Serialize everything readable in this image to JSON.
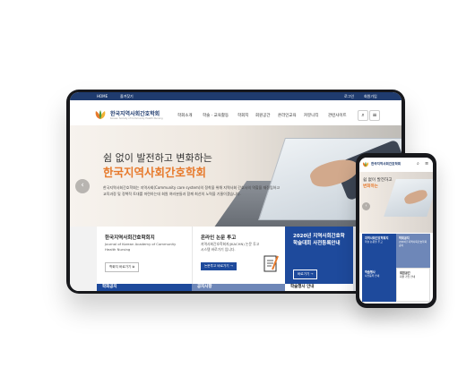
{
  "colors": {
    "brand_navy": "#1f3b6e",
    "brand_orange": "#e77a2c",
    "accent_blue": "#1e4a9c"
  },
  "tablet": {
    "topbar": {
      "home": "HOME",
      "bookmark": "즐겨찾기",
      "login": "로그인",
      "join": "회원가입"
    },
    "logo": {
      "title": "한국지역사회간호학회",
      "sub": "Korean Society of Community Health Nursing"
    },
    "menu": [
      "학회소개",
      "학술 · 교육활동",
      "학회지",
      "회원공간",
      "온라인교육",
      "커뮤니티",
      "관련사이트"
    ],
    "hero": {
      "line1": "쉼 없이 발전하고 변화하는",
      "line2": "한국지역사회간호학회",
      "desc": "한국지역사회간호학회는 지역사회(Community care system)의 정착을 위해 지역사회 간호사의 역할을 재정립하고 교육과정 및 정책적 토대를 마련하는데 회원 여러분들과 함께 최선의 노력을 기울이겠습니다."
    },
    "cards": [
      {
        "title": "한국지역사회간호학회지",
        "sub": "Journal of Korean Academy of Community Health Nursing",
        "button": "학회지 바로가기"
      },
      {
        "title": "온라인 논문 투고",
        "sub": "지역사회간호학회지(JKACHN) 논문 투고 시스템 바로가기 입니다.",
        "button": "논문투고 바로가기"
      },
      {
        "title": "2020년 지역사회간호학 학술대회 사전등록안내",
        "button": "바로가기"
      }
    ],
    "bottom_strips": [
      "학회공지",
      "공지사항",
      "학술행사 안내"
    ]
  },
  "phone": {
    "logo": "한국지역사회간호학회",
    "hero_line1": "쉼 없이 발전하고",
    "hero_line2": "변화하는",
    "cards": [
      {
        "title": "지역사회간호학회지",
        "sub": "학술 논문을 투고"
      },
      {
        "title": "학회공지",
        "sub": "2020년 지역사회간호학회 공지"
      },
      {
        "title": "학술행사",
        "sub": "사전등록 안내"
      },
      {
        "title": "회원공간",
        "sub": "회원 가입 안내"
      }
    ]
  }
}
